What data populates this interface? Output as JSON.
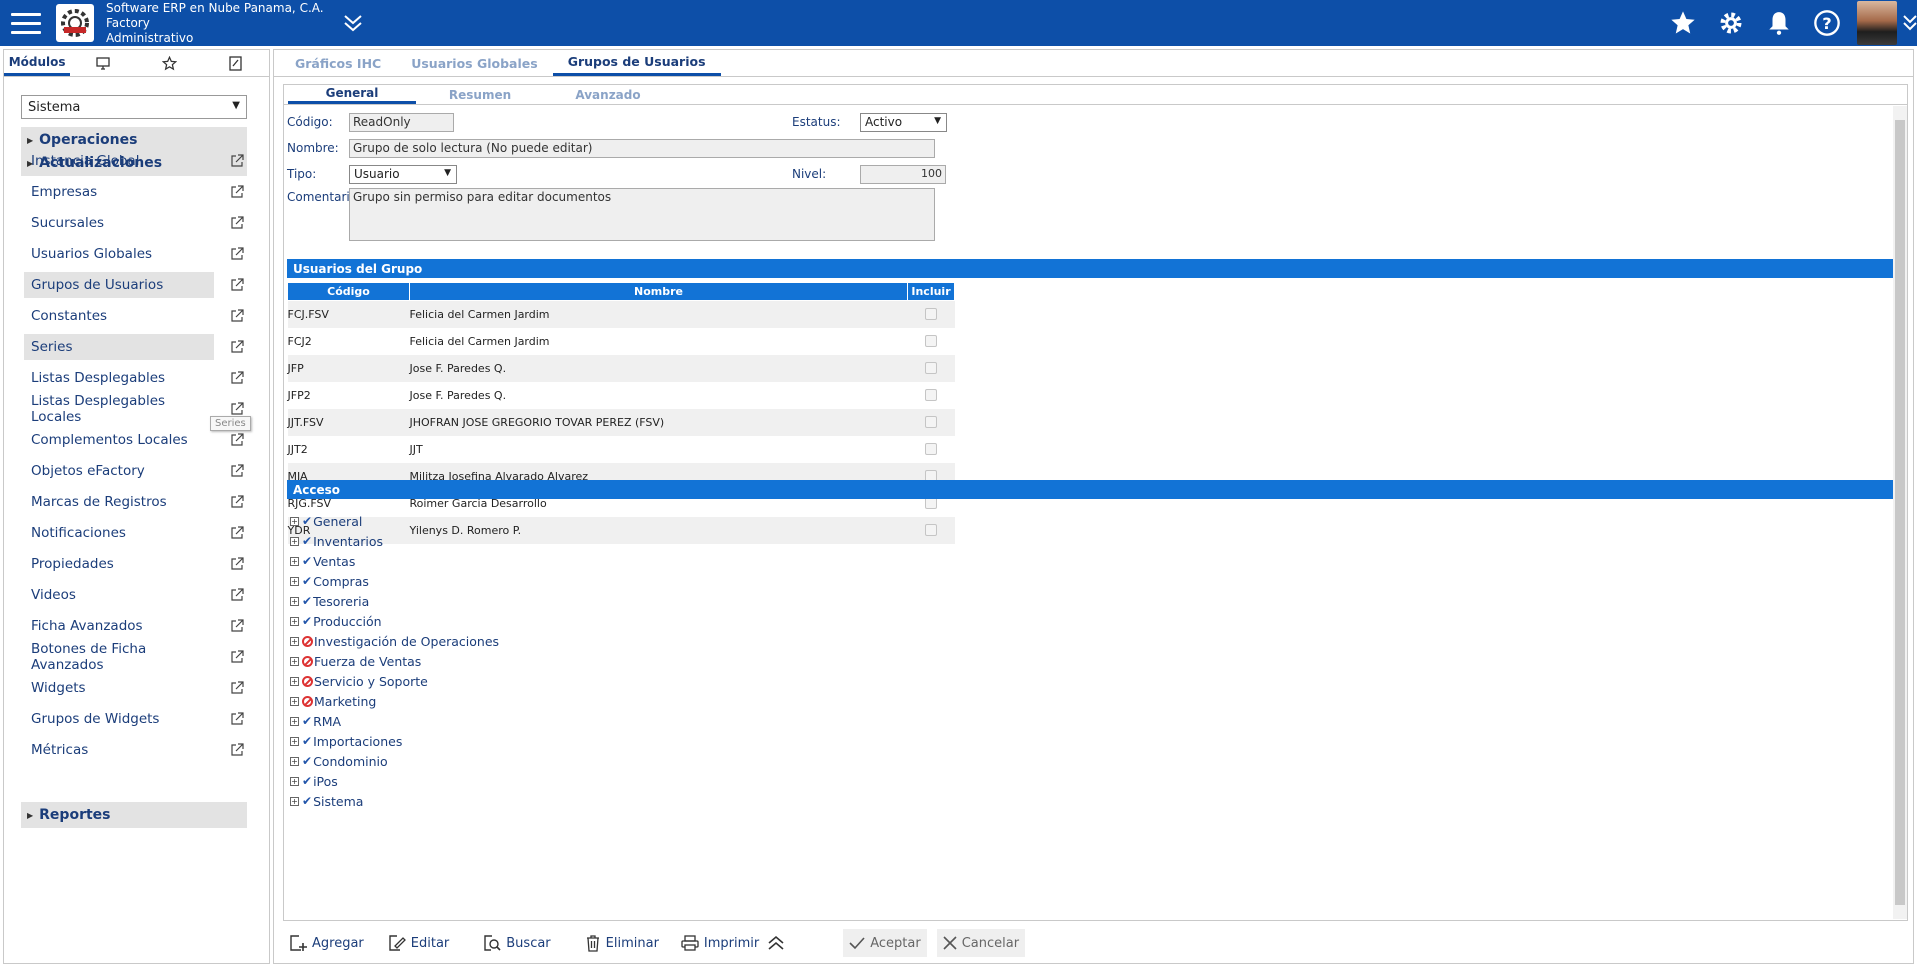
{
  "header": {
    "company_line1": "Software ERP en Nube Panama, C.A.",
    "company_line2": "Factory",
    "company_line3": "Administrativo"
  },
  "left_tabs": {
    "modules": "Módulos"
  },
  "module_select": "Sistema",
  "menu": {
    "group_operaciones": "Operaciones",
    "group_actualizaciones": "Actualizaciones",
    "group_reportes": "Reportes",
    "items": [
      "Instancia Global",
      "Empresas",
      "Sucursales",
      "Usuarios Globales",
      "Grupos de Usuarios",
      "Constantes",
      "Series",
      "Listas Desplegables",
      "Listas Desplegables Locales",
      "Complementos Locales",
      "Objetos eFactory",
      "Marcas de Registros",
      "Notificaciones",
      "Propiedades",
      "Videos",
      "Ficha Avanzados",
      "Botones de Ficha Avanzados",
      "Widgets",
      "Grupos de Widgets",
      "Métricas"
    ],
    "tooltip": "Series"
  },
  "main_tabs": [
    "Gráficos IHC",
    "Usuarios Globales",
    "Grupos de Usuarios"
  ],
  "sub_tabs": [
    "General",
    "Resumen",
    "Avanzado"
  ],
  "form": {
    "codigo_label": "Código:",
    "codigo_value": "ReadOnly",
    "estatus_label": "Estatus:",
    "estatus_value": "Activo",
    "nombre_label": "Nombre:",
    "nombre_value": "Grupo de solo lectura (No puede editar)",
    "tipo_label": "Tipo:",
    "tipo_value": "Usuario",
    "nivel_label": "Nivel:",
    "nivel_value": "100",
    "comentario_label": "Comentario:",
    "comentario_value": "Grupo sin permiso para editar documentos"
  },
  "usuarios_section": "Usuarios del Grupo",
  "users_table": {
    "headers": [
      "Código",
      "Nombre",
      "Incluir"
    ],
    "rows": [
      {
        "codigo": "FCJ.FSV",
        "nombre": "Felicia del Carmen Jardim"
      },
      {
        "codigo": "FCJ2",
        "nombre": "Felicia del Carmen Jardim"
      },
      {
        "codigo": "JFP",
        "nombre": "Jose F. Paredes Q."
      },
      {
        "codigo": "JFP2",
        "nombre": "Jose F. Paredes Q."
      },
      {
        "codigo": "JJT.FSV",
        "nombre": "JHOFRAN JOSE GREGORIO TOVAR PEREZ (FSV)"
      },
      {
        "codigo": "JJT2",
        "nombre": "JJT"
      },
      {
        "codigo": "MJA",
        "nombre": "Militza Josefina Alvarado Alvarez"
      },
      {
        "codigo": "RJG.FSV",
        "nombre": "Roimer Garcia Desarrollo"
      },
      {
        "codigo": "YDR",
        "nombre": "Yilenys D. Romero P."
      }
    ]
  },
  "acceso_section": "Acceso",
  "access_tree": [
    {
      "label": "General",
      "granted": true
    },
    {
      "label": "Inventarios",
      "granted": true
    },
    {
      "label": "Ventas",
      "granted": true
    },
    {
      "label": "Compras",
      "granted": true
    },
    {
      "label": "Tesoreria",
      "granted": true
    },
    {
      "label": "Producción",
      "granted": true
    },
    {
      "label": "Investigación de Operaciones",
      "granted": false
    },
    {
      "label": "Fuerza de Ventas",
      "granted": false
    },
    {
      "label": "Servicio y Soporte",
      "granted": false
    },
    {
      "label": "Marketing",
      "granted": false
    },
    {
      "label": "RMA",
      "granted": true
    },
    {
      "label": "Importaciones",
      "granted": true
    },
    {
      "label": "Condominio",
      "granted": true
    },
    {
      "label": "iPos",
      "granted": true
    },
    {
      "label": "Sistema",
      "granted": true
    }
  ],
  "toolbar": {
    "agregar": "Agregar",
    "editar": "Editar",
    "buscar": "Buscar",
    "eliminar": "Eliminar",
    "imprimir": "Imprimir",
    "aceptar": "Aceptar",
    "cancelar": "Cancelar"
  },
  "colors": {
    "brand": "#0d4fa8",
    "section": "#1273d6",
    "denied": "#dd3333"
  }
}
